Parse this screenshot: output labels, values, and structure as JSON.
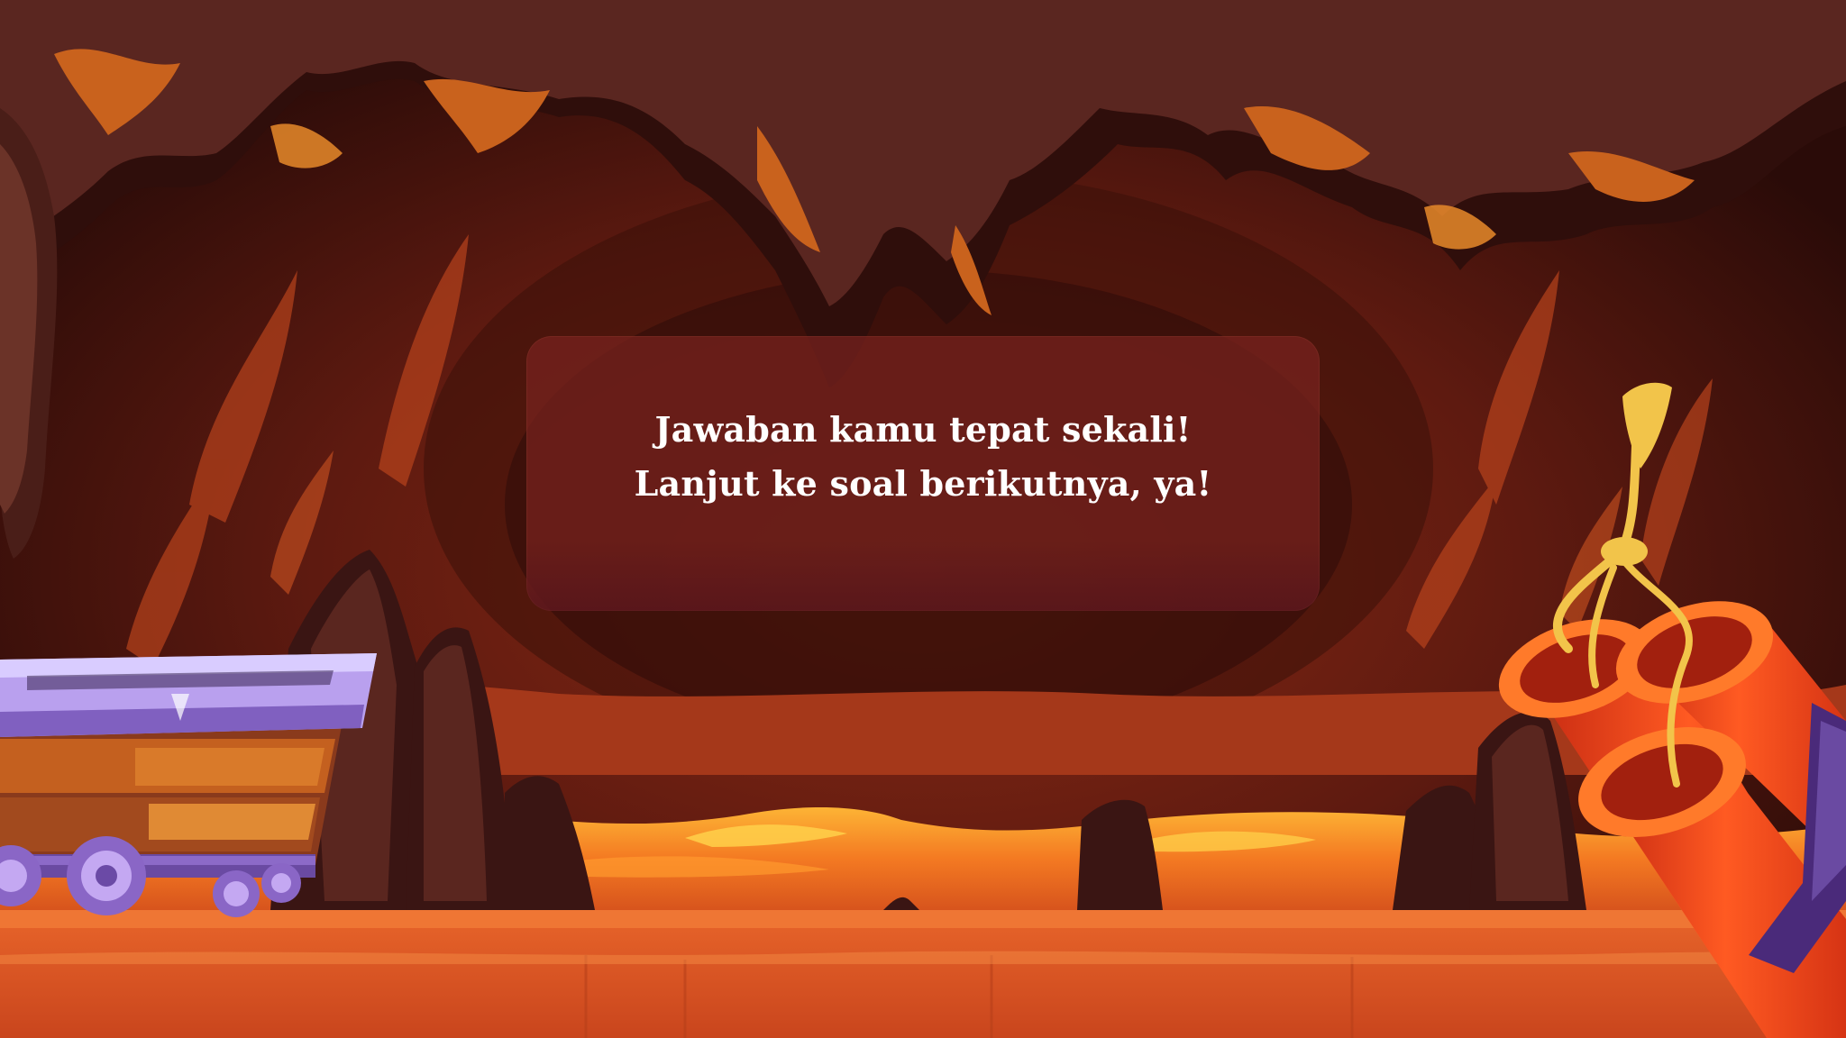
{
  "scene": {
    "name": "lava-cave",
    "colors": {
      "cave_dark": "#2b0d0b",
      "rock_brown": "#5a2a22",
      "lava_orange": "#e8631c",
      "lava_yellow": "#ffb23a",
      "dialog_fill": "#78221e",
      "cart_purple": "#9a7ad8",
      "dynamite_red": "#e33a1a"
    },
    "icons": [
      "mine-cart-icon",
      "dynamite-icon"
    ]
  },
  "dialog": {
    "line1": "Jawaban kamu tepat sekali!",
    "line2": "Lanjut ke soal berikutnya, ya!"
  }
}
